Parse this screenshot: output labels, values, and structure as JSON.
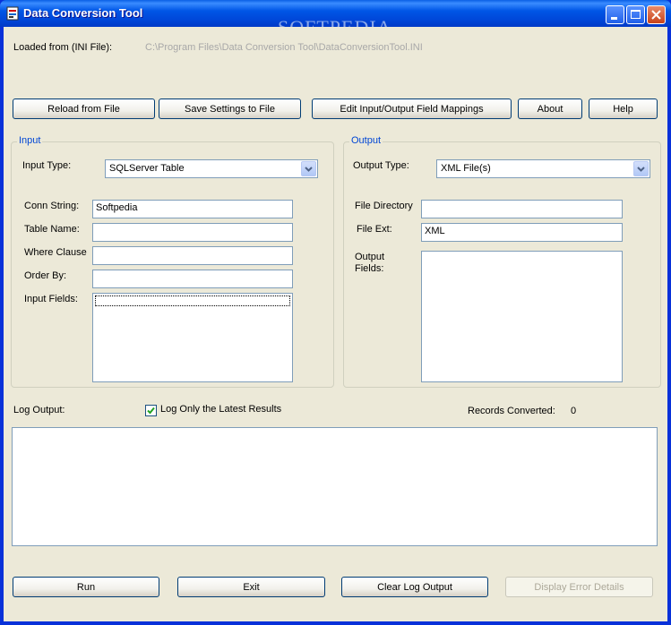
{
  "window": {
    "title": "Data Conversion Tool",
    "watermark": "SOFTPEDIA"
  },
  "header": {
    "loaded_label": "Loaded from (INI File):",
    "loaded_path": "C:\\Program Files\\Data Conversion Tool\\DataConversionTool.INI"
  },
  "toolbar": {
    "reload": "Reload from File",
    "save": "Save Settings to File",
    "mappings": "Edit Input/Output Field Mappings",
    "about": "About",
    "help": "Help"
  },
  "input": {
    "group_title": "Input",
    "type_label": "Input Type:",
    "type_value": "SQLServer Table",
    "conn_label": "Conn String:",
    "conn_value": "Softpedia",
    "table_label": "Table Name:",
    "table_value": "",
    "where_label": "Where Clause",
    "where_value": "",
    "order_label": "Order By:",
    "order_value": "",
    "fields_label": "Input Fields:"
  },
  "output": {
    "group_title": "Output",
    "type_label": "Output Type:",
    "type_value": "XML File(s)",
    "dir_label": "File Directory",
    "dir_value": "",
    "ext_label": "File Ext:",
    "ext_value": "XML",
    "fields_label": "Output\nFields:"
  },
  "log": {
    "label": "Log Output:",
    "only_latest_label": "Log Only the Latest Results",
    "only_latest_checked": true,
    "records_label": "Records Converted:",
    "records_value": "0"
  },
  "footer": {
    "run": "Run",
    "exit": "Exit",
    "clear": "Clear Log Output",
    "error_details": "Display Error Details"
  },
  "colors": {
    "titlebar": "#0054E3",
    "face": "#ECE9D8",
    "group_title": "#0046D5",
    "field_border": "#7F9DB9"
  }
}
